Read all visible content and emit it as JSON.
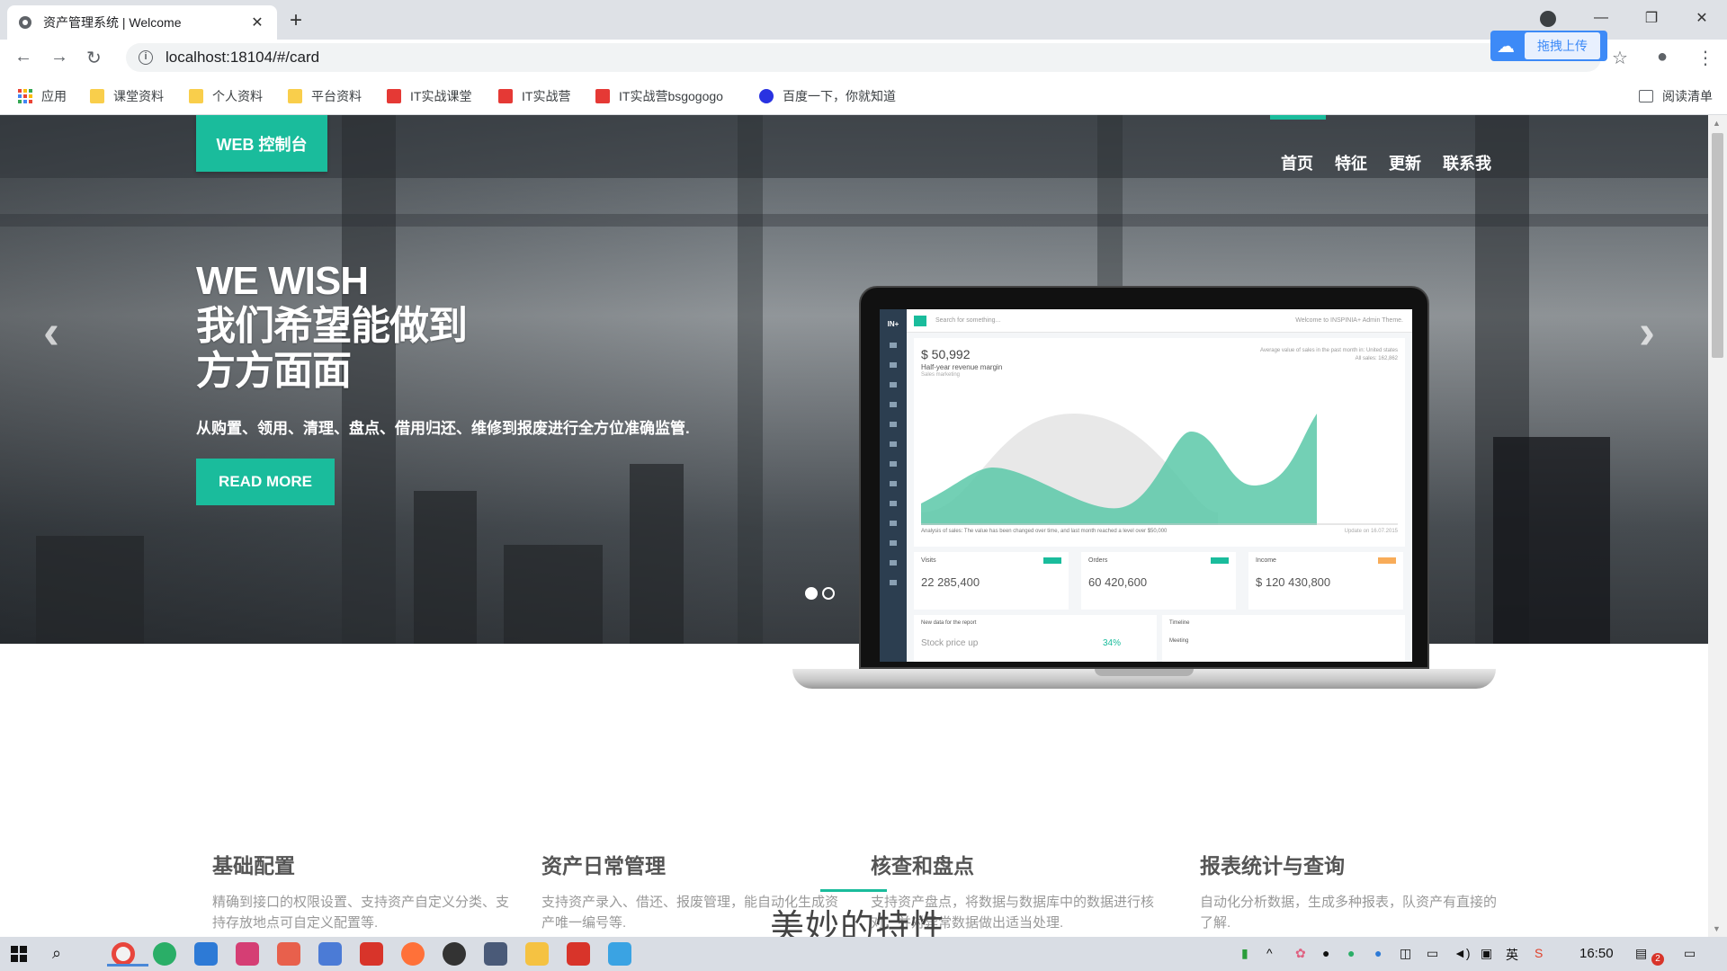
{
  "browser": {
    "tab_title": "资产管理系统 | Welcome",
    "tab_close": "✕",
    "new_tab": "+",
    "url": "localhost:18104/#/card",
    "extension_label": "拖拽上传",
    "bookmarks": [
      {
        "label": "应用",
        "icon": "apps-icon"
      },
      {
        "label": "课堂资料",
        "icon": "folder-icon"
      },
      {
        "label": "个人资料",
        "icon": "folder-icon"
      },
      {
        "label": "平台资料",
        "icon": "folder-icon"
      },
      {
        "label": "IT实战课堂",
        "icon": "site-icon"
      },
      {
        "label": "IT实战营",
        "icon": "site-icon"
      },
      {
        "label": "IT实战营bsgogogo",
        "icon": "site-icon"
      },
      {
        "label": "百度一下，你就知道",
        "icon": "baidu-icon"
      }
    ],
    "reading_list": "阅读清单"
  },
  "site": {
    "brand": "WEB 控制台",
    "nav": [
      "首页",
      "特征",
      "更新",
      "联系我"
    ],
    "hero": {
      "title_line1": "WE WISH",
      "title_line2": "我们希望能做到",
      "title_line3": "方方面面",
      "subtitle": "从购置、领用、清理、盘点、借用归还、维修到报废进行全方位准确监管.",
      "cta": "READ MORE"
    },
    "carousel": {
      "prev": "‹",
      "next": "›",
      "slides": 2,
      "active": 0
    },
    "dashboard_preview": {
      "logo": "IN+",
      "search_placeholder": "Search for something...",
      "welcome": "Welcome to INSPINIA+ Admin Theme.",
      "amount": "$ 50,992",
      "chart_label": "Half-year revenue margin",
      "chart_small": "Sales marketing",
      "right_note1": "Average value of sales in the past month in: United states",
      "right_note2": "All sales: 162,862",
      "foot": "Analysis of sales: The value has been changed over time, and last month reached a level over $50,000",
      "foot_right": "Update on 16.07.2015",
      "stats": [
        {
          "label": "Visits",
          "value": "22 285,400",
          "badge_color": "#1abc9c"
        },
        {
          "label": "Orders",
          "value": "60 420,600",
          "badge_color": "#1abc9c"
        },
        {
          "label": "Income",
          "value": "$ 120 430,800",
          "badge_color": "#f8ac59"
        }
      ],
      "report_title": "New data for the report",
      "report_text": "Stock price up",
      "report_pct": "34%",
      "timeline_title": "Timeline",
      "timeline_item": "Meeting"
    },
    "features": [
      {
        "title": "基础配置",
        "desc": "精确到接口的权限设置、支持资产自定义分类、支持存放地点可自定义配置等."
      },
      {
        "title": "资产日常管理",
        "desc": "支持资产录入、借还、报废管理，能自动化生成资产唯一编号等."
      },
      {
        "title": "核查和盘点",
        "desc": "支持资产盘点，将数据与数据库中的数据进行核对，并对异常数据做出适当处理."
      },
      {
        "title": "报表统计与查询",
        "desc": "自动化分析数据，生成多种报表，队资产有直接的了解."
      }
    ],
    "section_title": "美妙的特性"
  },
  "taskbar": {
    "clock": "16:50",
    "ime": "英",
    "notification_count": "2"
  },
  "colors": {
    "accent": "#1abc9c",
    "chrome_bg": "#dee1e6"
  }
}
